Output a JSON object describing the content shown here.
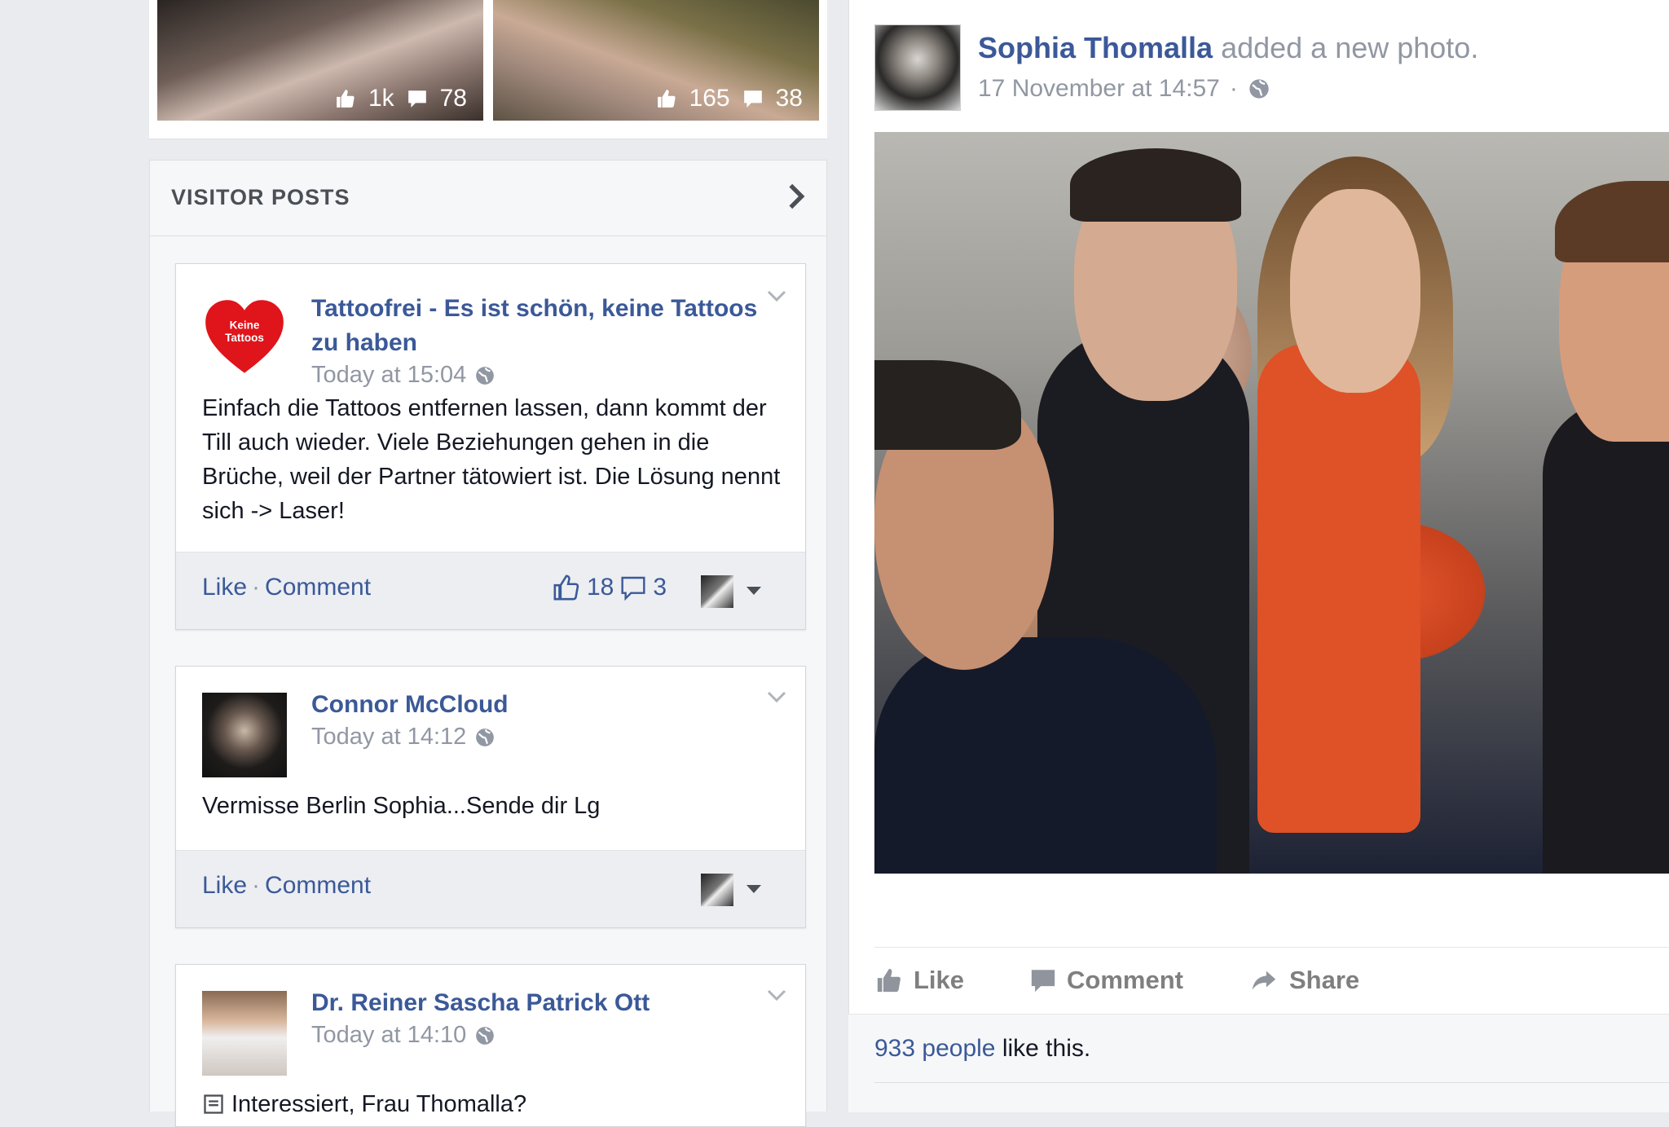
{
  "thumbnails": [
    {
      "likes": "1k",
      "comments": "78"
    },
    {
      "likes": "165",
      "comments": "38"
    }
  ],
  "visitor_posts": {
    "header": "VISITOR POSTS",
    "posts": [
      {
        "author": "Tattoofrei - Es ist schön, keine Tattoos zu haben",
        "avatar_text": "Keine Tattoos",
        "time": "Today at 15:04",
        "text": "Einfach die Tattoos entfernen lassen, dann kommt der Till auch wieder. Viele Beziehungen gehen in die Brüche, weil der Partner tätowiert ist. Die Lösung nennt sich -> Laser!",
        "like_label": "Like",
        "comment_label": "Comment",
        "like_count": "18",
        "comment_count": "3"
      },
      {
        "author": "Connor McCloud",
        "time": "Today at 14:12",
        "text": "Vermisse Berlin Sophia...Sende dir Lg",
        "like_label": "Like",
        "comment_label": "Comment"
      },
      {
        "author": "Dr. Reiner Sascha Patrick Ott",
        "time": "Today at 14:10",
        "text": "Interessiert, Frau Thomalla?"
      }
    ]
  },
  "main_post": {
    "author": "Sophia Thomalla",
    "action": "added a new photo.",
    "time": "17 November at 14:57",
    "like_label": "Like",
    "comment_label": "Comment",
    "share_label": "Share",
    "likes_count_link": "933 people",
    "likes_suffix": "like this."
  },
  "colors": {
    "link": "#3b5998",
    "secondary": "#9197a3",
    "background": "#e9ebee"
  },
  "icons": [
    "thumbs-up-icon",
    "comment-icon",
    "share-icon",
    "globe-icon",
    "chevron-right-icon",
    "chevron-down-icon",
    "dropdown-caret-icon"
  ]
}
